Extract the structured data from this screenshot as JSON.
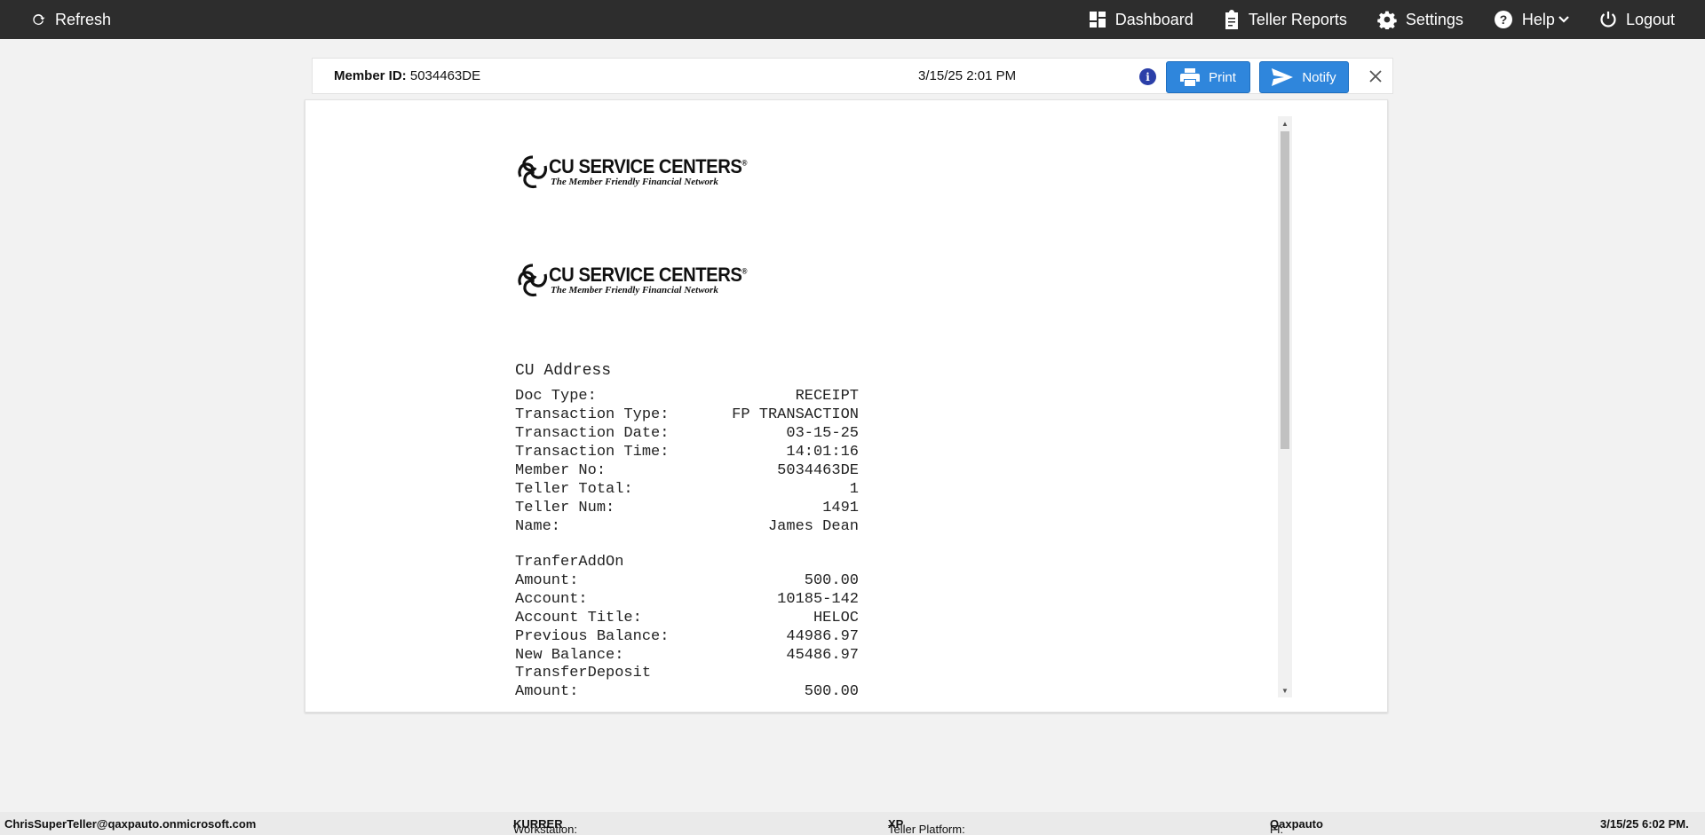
{
  "topbar": {
    "refresh_label": "Refresh",
    "dashboard_label": "Dashboard",
    "teller_reports_label": "Teller Reports",
    "settings_label": "Settings",
    "help_label": "Help",
    "logout_label": "Logout"
  },
  "header": {
    "member_id_label": "Member ID:",
    "member_id_value": "5034463DE",
    "datetime": "3/15/25 2:01 PM",
    "info_icon": "i",
    "print_label": "Print",
    "notify_label": "Notify"
  },
  "receipt": {
    "logo_title": "CU SERVICE CENTERS",
    "logo_registered": "®",
    "logo_tagline": "The Member Friendly Financial Network",
    "address_heading": "CU Address",
    "summary": [
      {
        "label": "Doc Type:",
        "value": "RECEIPT"
      },
      {
        "label": "Transaction Type:",
        "value": "FP TRANSACTION"
      },
      {
        "label": "Transaction Date:",
        "value": "03-15-25"
      },
      {
        "label": "Transaction Time:",
        "value": "14:01:16"
      },
      {
        "label": "Member No:",
        "value": "5034463DE"
      },
      {
        "label": "Teller Total:",
        "value": "1"
      },
      {
        "label": "Teller Num:",
        "value": "1491"
      },
      {
        "label": "Name:",
        "value": "James Dean"
      }
    ],
    "section1_title": "TranferAddOn",
    "section1": [
      {
        "label": "Amount:",
        "value": "500.00"
      },
      {
        "label": "Account:",
        "value": "10185-142"
      },
      {
        "label": "Account Title:",
        "value": "HELOC"
      },
      {
        "label": "Previous Balance:",
        "value": "44986.97"
      },
      {
        "label": "New Balance:",
        "value": "45486.97"
      }
    ],
    "section2_title": "TransferDeposit",
    "section2": [
      {
        "label": "Amount:",
        "value": "500.00"
      }
    ]
  },
  "footer": {
    "user": "ChrisSuperTeller@qaxpauto.onmicrosoft.com",
    "workstation_label": "Workstation:",
    "workstation_value": "KURRER",
    "platform_label": "Teller Platform:",
    "platform_value": "XP",
    "fi_label": "FI:",
    "fi_value": "Qaxpauto",
    "datetime": "3/15/25 6:02 PM."
  },
  "icons": {
    "refresh": "refresh-icon",
    "dashboard": "dashboard-icon",
    "reports": "clipboard-icon",
    "settings": "gear-icon",
    "help": "question-icon",
    "logout": "power-icon",
    "print": "printer-icon",
    "notify": "send-icon",
    "close": "close-icon"
  },
  "colors": {
    "topbar": "#2d2d2d",
    "button": "#2f86dc",
    "info": "#2b3fa8"
  }
}
